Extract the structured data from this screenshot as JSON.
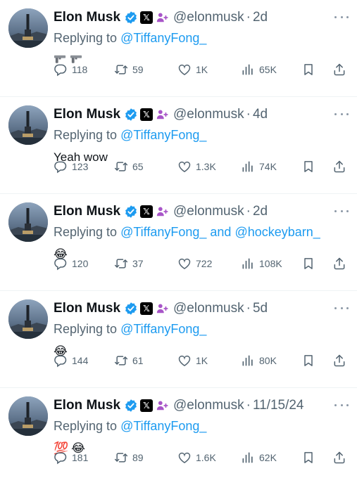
{
  "tweets": [
    {
      "name": "Elon Musk",
      "x_badge": "𝕏",
      "handle": "@elonmusk",
      "sep": "·",
      "time": "2d",
      "reply_prefix": "Replying to ",
      "mention1": "@TiffanyFong_",
      "joiner": "",
      "mention2": "",
      "text": "",
      "emoji": [
        "gun-icon",
        "gun-icon"
      ],
      "stats": {
        "replies": "118",
        "reposts": "59",
        "likes": "1K",
        "views": "65K"
      }
    },
    {
      "name": "Elon Musk",
      "x_badge": "𝕏",
      "handle": "@elonmusk",
      "sep": "·",
      "time": "4d",
      "reply_prefix": "Replying to ",
      "mention1": "@TiffanyFong_",
      "joiner": "",
      "mention2": "",
      "text": "Yeah wow",
      "emoji": [],
      "stats": {
        "replies": "123",
        "reposts": "65",
        "likes": "1.3K",
        "views": "74K"
      }
    },
    {
      "name": "Elon Musk",
      "x_badge": "𝕏",
      "handle": "@elonmusk",
      "sep": "·",
      "time": "2d",
      "reply_prefix": "Replying to ",
      "mention1": "@TiffanyFong_",
      "joiner": " and ",
      "mention2": "@hockeybarn_",
      "text": "",
      "emoji": [
        "😂"
      ],
      "stats": {
        "replies": "120",
        "reposts": "37",
        "likes": "722",
        "views": "108K"
      }
    },
    {
      "name": "Elon Musk",
      "x_badge": "𝕏",
      "handle": "@elonmusk",
      "sep": "·",
      "time": "5d",
      "reply_prefix": "Replying to ",
      "mention1": "@TiffanyFong_",
      "joiner": "",
      "mention2": "",
      "text": "",
      "emoji": [
        "😂"
      ],
      "stats": {
        "replies": "144",
        "reposts": "61",
        "likes": "1K",
        "views": "80K"
      }
    },
    {
      "name": "Elon Musk",
      "x_badge": "𝕏",
      "handle": "@elonmusk",
      "sep": "·",
      "time": "11/15/24",
      "reply_prefix": "Replying to ",
      "mention1": "@TiffanyFong_",
      "joiner": "",
      "mention2": "",
      "text": "",
      "emoji": [
        "💯",
        "😂"
      ],
      "stats": {
        "replies": "181",
        "reposts": "89",
        "likes": "1.6K",
        "views": "62K"
      }
    }
  ],
  "colors": {
    "accent": "#1d9bf0",
    "muted": "#536471",
    "text": "#0f1419",
    "divider": "#eff3f4",
    "affiliation": "#a855c8"
  }
}
